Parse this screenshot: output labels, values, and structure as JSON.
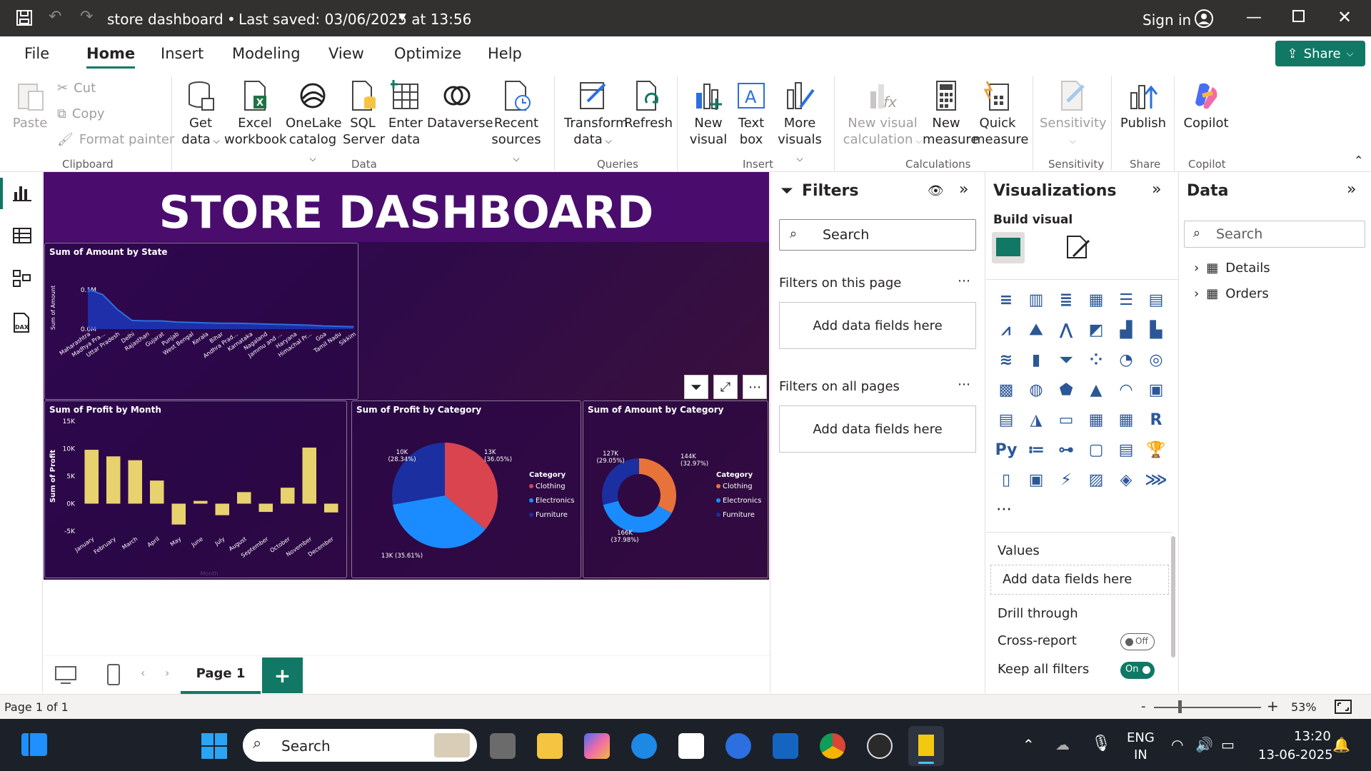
{
  "titlebar": {
    "doc_title": "store dashboard",
    "saved": "Last saved: 03/06/2025 at 13:56",
    "sign_in": "Sign in"
  },
  "menu_tabs": [
    "File",
    "Home",
    "Insert",
    "Modeling",
    "View",
    "Optimize",
    "Help"
  ],
  "share_label": "Share",
  "ribbon": {
    "clipboard": {
      "paste": "Paste",
      "cut": "Cut",
      "copy": "Copy",
      "format_painter": "Format painter",
      "group": "Clipboard"
    },
    "data": {
      "get_data": [
        "Get",
        "data"
      ],
      "excel": [
        "Excel",
        "workbook"
      ],
      "onelake": [
        "OneLake",
        "catalog"
      ],
      "sql": [
        "SQL",
        "Server"
      ],
      "enter": [
        "Enter",
        "data"
      ],
      "dataverse": "Dataverse",
      "recent": [
        "Recent",
        "sources"
      ],
      "group": "Data"
    },
    "queries": {
      "transform": [
        "Transform",
        "data"
      ],
      "refresh": "Refresh",
      "group": "Queries"
    },
    "insert": {
      "new_visual": [
        "New",
        "visual"
      ],
      "text_box": [
        "Text",
        "box"
      ],
      "more_visuals": [
        "More",
        "visuals"
      ],
      "group": "Insert"
    },
    "calculations": {
      "new_visual_calc": [
        "New visual",
        "calculation"
      ],
      "new_measure": [
        "New",
        "measure"
      ],
      "quick_measure": [
        "Quick",
        "measure"
      ],
      "group": "Calculations"
    },
    "sensitivity": {
      "label": "Sensitivity",
      "group": "Sensitivity"
    },
    "share": {
      "publish": "Publish",
      "group": "Share"
    },
    "copilot": {
      "label": "Copilot",
      "group": "Copilot"
    }
  },
  "dashboard": {
    "title": "STORE DASHBOARD",
    "colors": {
      "bar_yellow": "#e8d26e",
      "line_blue": "#2b6fe0",
      "clothing": "#d9444f",
      "electronics": "#1a8cff",
      "furniture": "#1b2fa0",
      "donut_clothing": "#e8733a"
    }
  },
  "chart_data": [
    {
      "type": "area",
      "title": "Sum of Amount by State",
      "ylabel": "Sum of Amount",
      "xlabel": "",
      "categories": [
        "Maharashtra",
        "Madhya Pra...",
        "Uttar Pradesh",
        "Delhi",
        "Rajasthan",
        "Gujarat",
        "Punjab",
        "West Bengal",
        "Kerala",
        "Bihar",
        "Andhra Prad...",
        "Karnataka",
        "Nagaland",
        "Jammu and ...",
        "Haryana",
        "Himachal Pr...",
        "Goa",
        "Tamil Nadu",
        "Sikkim"
      ],
      "values": [
        0.102,
        0.088,
        0.05,
        0.022,
        0.021,
        0.021,
        0.018,
        0.017,
        0.016,
        0.015,
        0.015,
        0.014,
        0.013,
        0.012,
        0.011,
        0.01,
        0.008,
        0.007,
        0.006
      ],
      "y_tick_labels": [
        "0.0M",
        "0.1M"
      ],
      "ylim": [
        0,
        0.12
      ]
    },
    {
      "type": "bar",
      "title": "Sum of Profit by Month",
      "ylabel": "Sum of Profit",
      "xlabel": "Month",
      "categories": [
        "January",
        "February",
        "March",
        "April",
        "May",
        "June",
        "July",
        "August",
        "September",
        "October",
        "November",
        "December"
      ],
      "values": [
        9800,
        8600,
        7900,
        4200,
        -3800,
        500,
        -2100,
        2100,
        -1500,
        2900,
        10200,
        -1600
      ],
      "y_tick_labels": [
        "-5K",
        "0K",
        "5K",
        "10K",
        "15K"
      ],
      "ylim": [
        -5000,
        15000
      ]
    },
    {
      "type": "pie",
      "title": "Sum of Profit by Category",
      "legend_title": "Category",
      "labels": [
        "Clothing",
        "Electronics",
        "Furniture"
      ],
      "values": [
        13000,
        13000,
        10000
      ],
      "data_labels": [
        "13K\n(36.05%)",
        "13K (35.61%)",
        "10K\n(28.34%)"
      ],
      "legend": "right"
    },
    {
      "type": "pie",
      "title": "Sum of Amount by Category",
      "legend_title": "Category",
      "labels": [
        "Clothing",
        "Electronics",
        "Furniture"
      ],
      "values": [
        144000,
        166000,
        127000
      ],
      "data_labels": [
        "144K\n(32.97%)",
        "166K\n(37.98%)",
        "127K\n(29.05%)"
      ],
      "legend": "right"
    }
  ],
  "filters": {
    "title": "Filters",
    "search_placeholder": "Search",
    "on_page": "Filters on this page",
    "on_all": "Filters on all pages",
    "add_fields": "Add data fields here"
  },
  "visualizations": {
    "title": "Visualizations",
    "build_visual": "Build visual",
    "values": "Values",
    "add_fields": "Add data fields here",
    "drill": "Drill through",
    "cross_report": "Cross-report",
    "off": "Off",
    "keep_filters": "Keep all filters",
    "on": "On"
  },
  "data_pane": {
    "title": "Data",
    "search_placeholder": "Search",
    "tables": [
      "Details",
      "Orders"
    ]
  },
  "page_tabs": {
    "page1": "Page 1",
    "add": "+"
  },
  "status": {
    "page": "Page 1 of 1",
    "zoom": "53%"
  },
  "taskbar": {
    "search": "Search",
    "lang1": "ENG",
    "lang2": "IN",
    "time": "13:20",
    "date": "13-06-2025"
  }
}
